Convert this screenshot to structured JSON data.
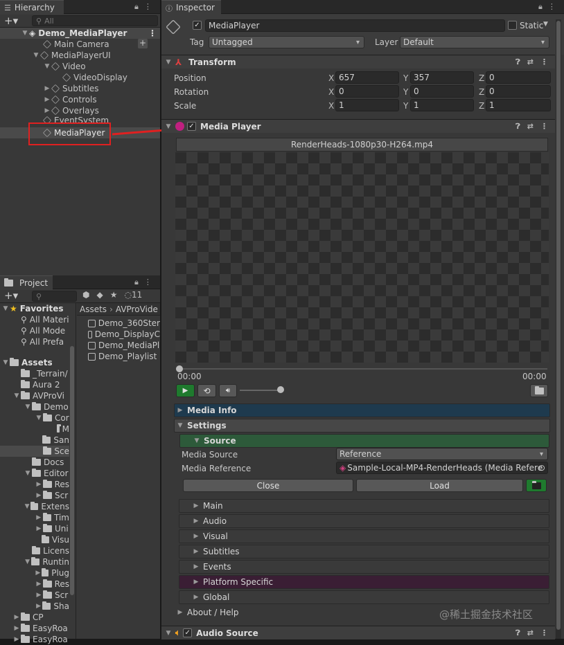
{
  "hierarchy": {
    "tab": "Hierarchy",
    "search_placeholder": "All",
    "scene": "Demo_MediaPlayer",
    "items": [
      "Main Camera",
      "MediaPlayerUI",
      "Video",
      "VideoDisplay",
      "Subtitles",
      "Controls",
      "Overlays",
      "EventSystem",
      "MediaPlayer"
    ]
  },
  "project": {
    "tab": "Project",
    "count": "11",
    "favorites": "Favorites",
    "fav_items": [
      "All Materi",
      "All Mode",
      "All Prefa"
    ],
    "assets": "Assets",
    "tree": [
      "_Terrain/",
      "Aura 2",
      "AVProVi",
      "Demo",
      "Cor",
      "M",
      "San",
      "Sce",
      "Docs",
      "Editor",
      "Res",
      "Scr",
      "Extens",
      "Tim",
      "Uni",
      "Visu",
      "Licens",
      "Runtin",
      "Plug",
      "Res",
      "Scr",
      "Sha",
      "CP",
      "EasyRoa",
      "EasyRoa"
    ],
    "breadcrumb": [
      "Assets",
      "AVProVide"
    ],
    "files": [
      "Demo_360Ster",
      "Demo_DisplayC",
      "Demo_MediaPl",
      "Demo_Playlist"
    ]
  },
  "inspector": {
    "tab": "Inspector",
    "name": "MediaPlayer",
    "static": "Static",
    "tag_label": "Tag",
    "tag": "Untagged",
    "layer_label": "Layer",
    "layer": "Default",
    "transform": {
      "title": "Transform",
      "rows": [
        {
          "label": "Position",
          "x": "657",
          "y": "357",
          "z": "0"
        },
        {
          "label": "Rotation",
          "x": "0",
          "y": "0",
          "z": "0"
        },
        {
          "label": "Scale",
          "x": "1",
          "y": "1",
          "z": "1"
        }
      ],
      "axes": [
        "X",
        "Y",
        "Z"
      ]
    },
    "media_player": {
      "title": "Media Player",
      "file": "RenderHeads-1080p30-H264.mp4",
      "time_start": "00:00",
      "time_end": "00:00",
      "media_info": "Media Info",
      "settings": "Settings",
      "source": "Source",
      "media_source_label": "Media Source",
      "media_source": "Reference",
      "media_ref_label": "Media Reference",
      "media_ref": "Sample-Local-MP4-RenderHeads (Media Refere",
      "close": "Close",
      "load": "Load",
      "sections": [
        "Main",
        "Audio",
        "Visual",
        "Subtitles",
        "Events",
        "Platform Specific",
        "Global"
      ],
      "about": "About / Help"
    },
    "audio_source": "Audio Source"
  },
  "watermark": "@稀土掘金技术社区",
  "colors": {
    "highlight_red": "#e02020",
    "source_green": "#2d5a3a",
    "platform_purple": "#3a1e34",
    "media_info_blue": "#1e3a4e"
  }
}
